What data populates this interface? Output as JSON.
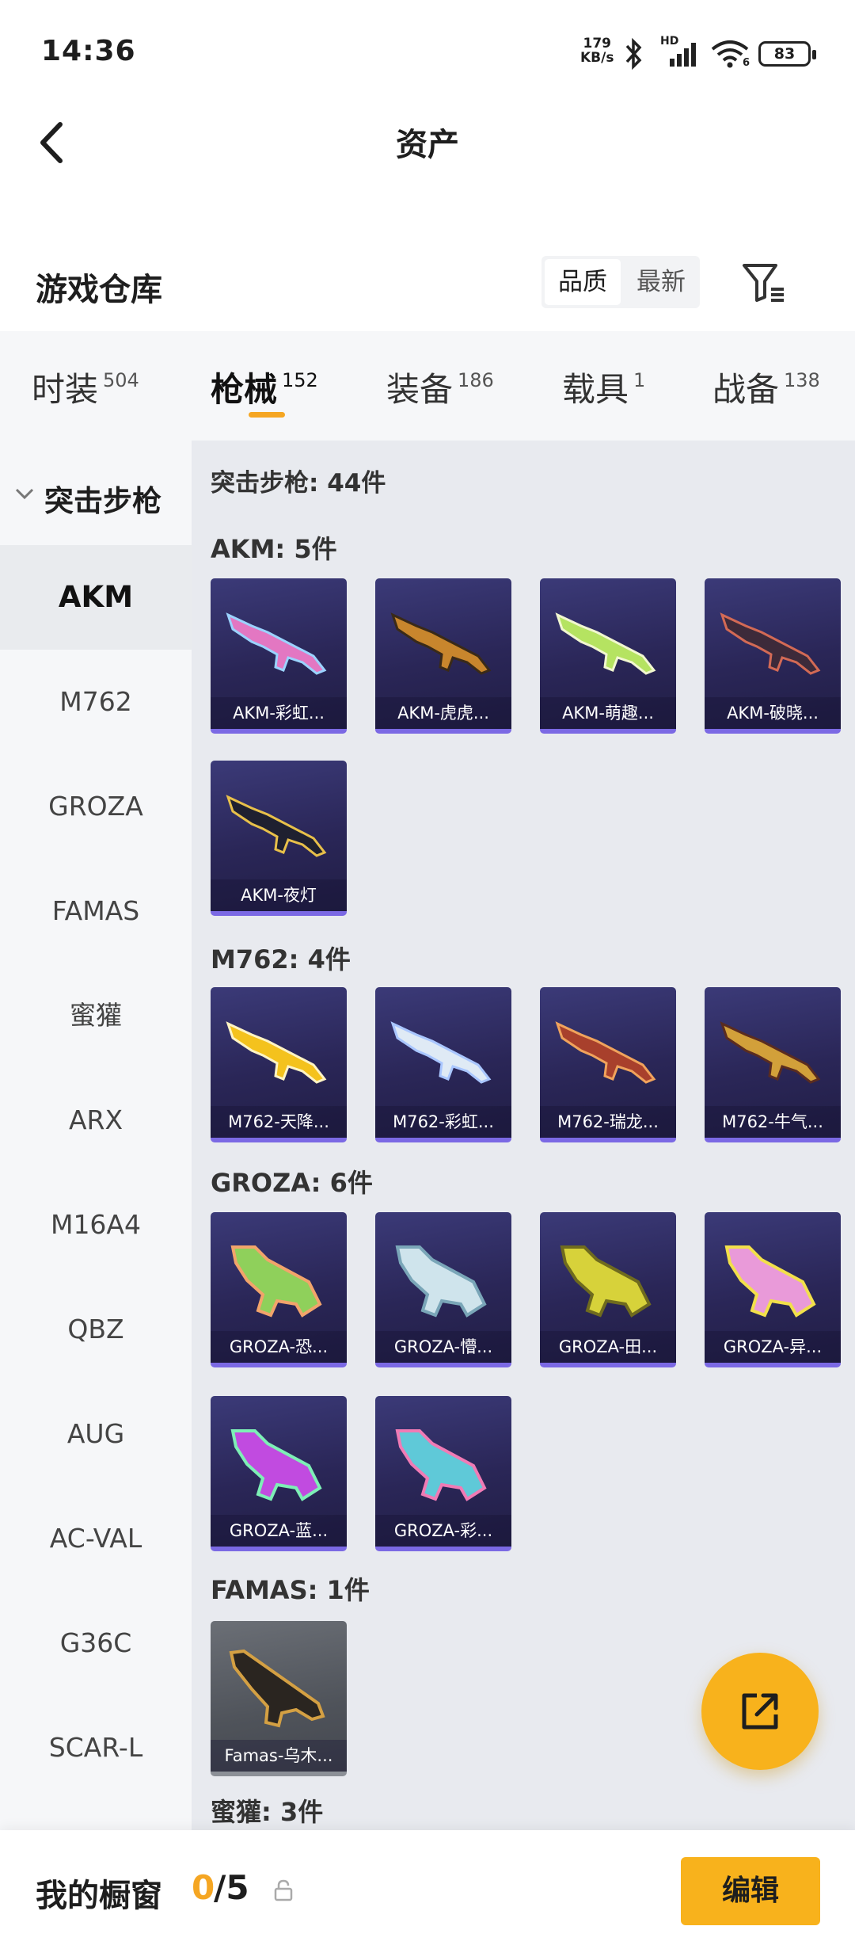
{
  "status": {
    "time": "14:36",
    "speed_value": "179",
    "speed_unit": "KB/s",
    "battery": "83",
    "wifi_label": "6",
    "signal_label": "HD"
  },
  "header": {
    "title": "资产"
  },
  "section": {
    "title": "游戏仓库",
    "sort_quality": "品质",
    "sort_newest": "最新"
  },
  "tabs": [
    {
      "label": "时装",
      "count": "504"
    },
    {
      "label": "枪械",
      "count": "152"
    },
    {
      "label": "装备",
      "count": "186"
    },
    {
      "label": "载具",
      "count": "1"
    },
    {
      "label": "战备",
      "count": "138"
    }
  ],
  "sidebar": {
    "group": "突击步枪",
    "items": [
      "AKM",
      "M762",
      "GROZA",
      "FAMAS",
      "蜜獾",
      "ARX",
      "M16A4",
      "QBZ",
      "AUG",
      "AC-VAL",
      "G36C",
      "SCAR-L"
    ]
  },
  "main": {
    "head": "突击步枪: 44件",
    "categories": [
      {
        "label": "AKM: 5件",
        "items": [
          "AKM-彩虹...",
          "AKM-虎虎...",
          "AKM-萌趣...",
          "AKM-破晓...",
          "AKM-夜灯"
        ]
      },
      {
        "label": "M762: 4件",
        "items": [
          "M762-天降...",
          "M762-彩虹...",
          "M762-瑞龙...",
          "M762-牛气..."
        ]
      },
      {
        "label": "GROZA: 6件",
        "items": [
          "GROZA-恐...",
          "GROZA-懵...",
          "GROZA-田...",
          "GROZA-异...",
          "GROZA-蓝...",
          "GROZA-彩..."
        ]
      },
      {
        "label": "FAMAS: 1件",
        "items": [
          "Famas-乌木..."
        ]
      },
      {
        "label": "蜜獾: 3件",
        "items": []
      }
    ]
  },
  "icons": {
    "back": "back-arrow-icon",
    "filter": "filter-icon",
    "share": "share-icon",
    "lock": "lock-icon"
  },
  "bottom": {
    "label": "我的橱窗",
    "count_current": "0",
    "count_total": "/5",
    "edit_label": "编辑"
  },
  "colors": {
    "accent": "#f8b21c",
    "tab_underline": "#f5a623",
    "card_bg": "#2a2657",
    "card_border": "#7b69e4"
  }
}
